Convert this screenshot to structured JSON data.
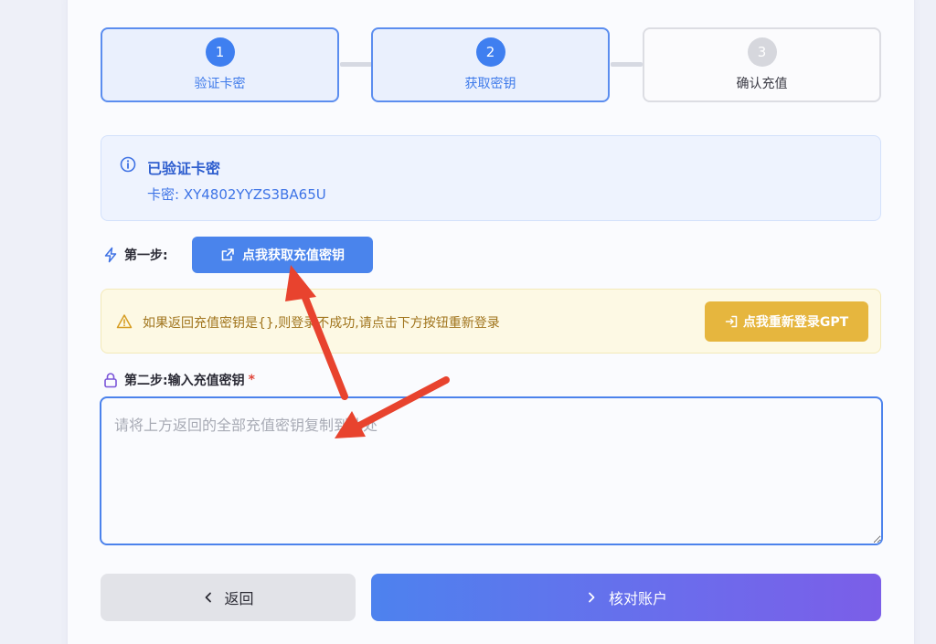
{
  "steps": [
    {
      "num": "1",
      "label": "验证卡密",
      "state": "done"
    },
    {
      "num": "2",
      "label": "获取密钥",
      "state": "active"
    },
    {
      "num": "3",
      "label": "确认充值",
      "state": "pending"
    }
  ],
  "info": {
    "title": "已验证卡密",
    "code_text": "卡密: XY4802YYZS3BA65U",
    "icon": "info-circle-icon"
  },
  "step1": {
    "label": "第一步:",
    "icon": "lightning-icon",
    "button_label": "点我获取充值密钥",
    "button_icon": "external-link-icon"
  },
  "warning": {
    "text": "如果返回充值密钥是{},则登录不成功,请点击下方按钮重新登录",
    "button_label": "点我重新登录GPT",
    "icon": "warning-triangle-icon",
    "button_icon": "login-icon"
  },
  "step2": {
    "label": "第二步:输入充值密钥",
    "required_mark": "*",
    "icon": "lock-icon",
    "placeholder": "请将上方返回的全部充值密钥复制到此处"
  },
  "actions": {
    "back_label": "返回",
    "verify_label": "核对账户"
  },
  "colors": {
    "primary": "#4a84ec",
    "warning": "#e6b63e",
    "annotation_arrow": "#e8432e"
  }
}
